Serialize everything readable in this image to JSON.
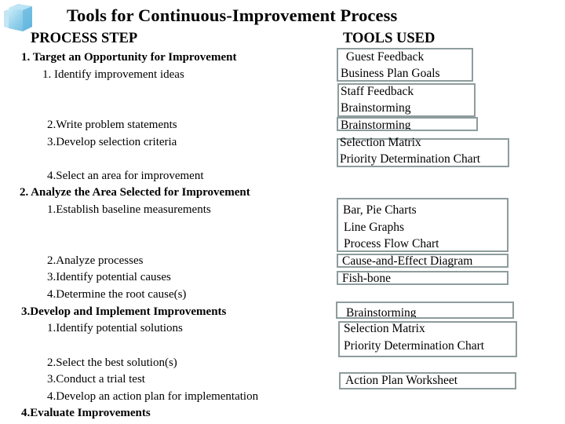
{
  "title": "Tools for Continuous-Improvement Process",
  "logo_icon": "cube-icon",
  "headers": {
    "process_step": "PROCESS STEP",
    "tools_used": "TOOLS USED"
  },
  "steps": [
    {
      "text": "1.  Target an Opportunity for Improvement",
      "type": "main"
    },
    {
      "text": "1. Identify improvement ideas",
      "type": "sub"
    },
    {
      "text": "2.Write problem statements",
      "type": "sub"
    },
    {
      "text": "3.Develop selection criteria",
      "type": "sub"
    },
    {
      "text": "4.Select an area for improvement",
      "type": "sub"
    },
    {
      "text": "2. Analyze the Area Selected for Improvement",
      "type": "main"
    },
    {
      "text": "1.Establish baseline measurements",
      "type": "sub"
    },
    {
      "text": "2.Analyze processes",
      "type": "sub"
    },
    {
      "text": "3.Identify potential causes",
      "type": "sub"
    },
    {
      "text": "4.Determine the root cause(s)",
      "type": "sub"
    },
    {
      "text": "3.Develop and Implement Improvements",
      "type": "main"
    },
    {
      "text": "1.Identify potential solutions",
      "type": "sub"
    },
    {
      "text": "2.Select the best solution(s)",
      "type": "sub"
    },
    {
      "text": "3.Conduct a trial test",
      "type": "sub"
    },
    {
      "text": "4.Develop an action plan for implementation",
      "type": "sub"
    },
    {
      "text": "4.Evaluate Improvements",
      "type": "main"
    }
  ],
  "tool_boxes": [
    {
      "lines": [
        " Guest Feedback",
        "Business Plan Goals"
      ]
    },
    {
      "lines": [
        "Staff Feedback",
        "Brainstorming"
      ]
    },
    {
      "lines": [
        "Brainstorming"
      ]
    },
    {
      "lines": [
        "Selection Matrix",
        "Priority Determination Chart"
      ]
    },
    {
      "lines": [
        "Bar, Pie Charts",
        "Line Graphs",
        "Process Flow Chart"
      ]
    },
    {
      "lines": [
        "Cause-and-Effect Diagram"
      ]
    },
    {
      "lines": [
        "Fish-bone"
      ]
    },
    {
      "lines": [
        "Brainstorming"
      ]
    },
    {
      "lines": [
        "Selection Matrix",
        "Priority Determination Chart"
      ]
    },
    {
      "lines": [
        "Action Plan Worksheet"
      ]
    }
  ],
  "colors": {
    "box_border": "#8e9c9c",
    "logo_blue": "#7fc8e8"
  }
}
